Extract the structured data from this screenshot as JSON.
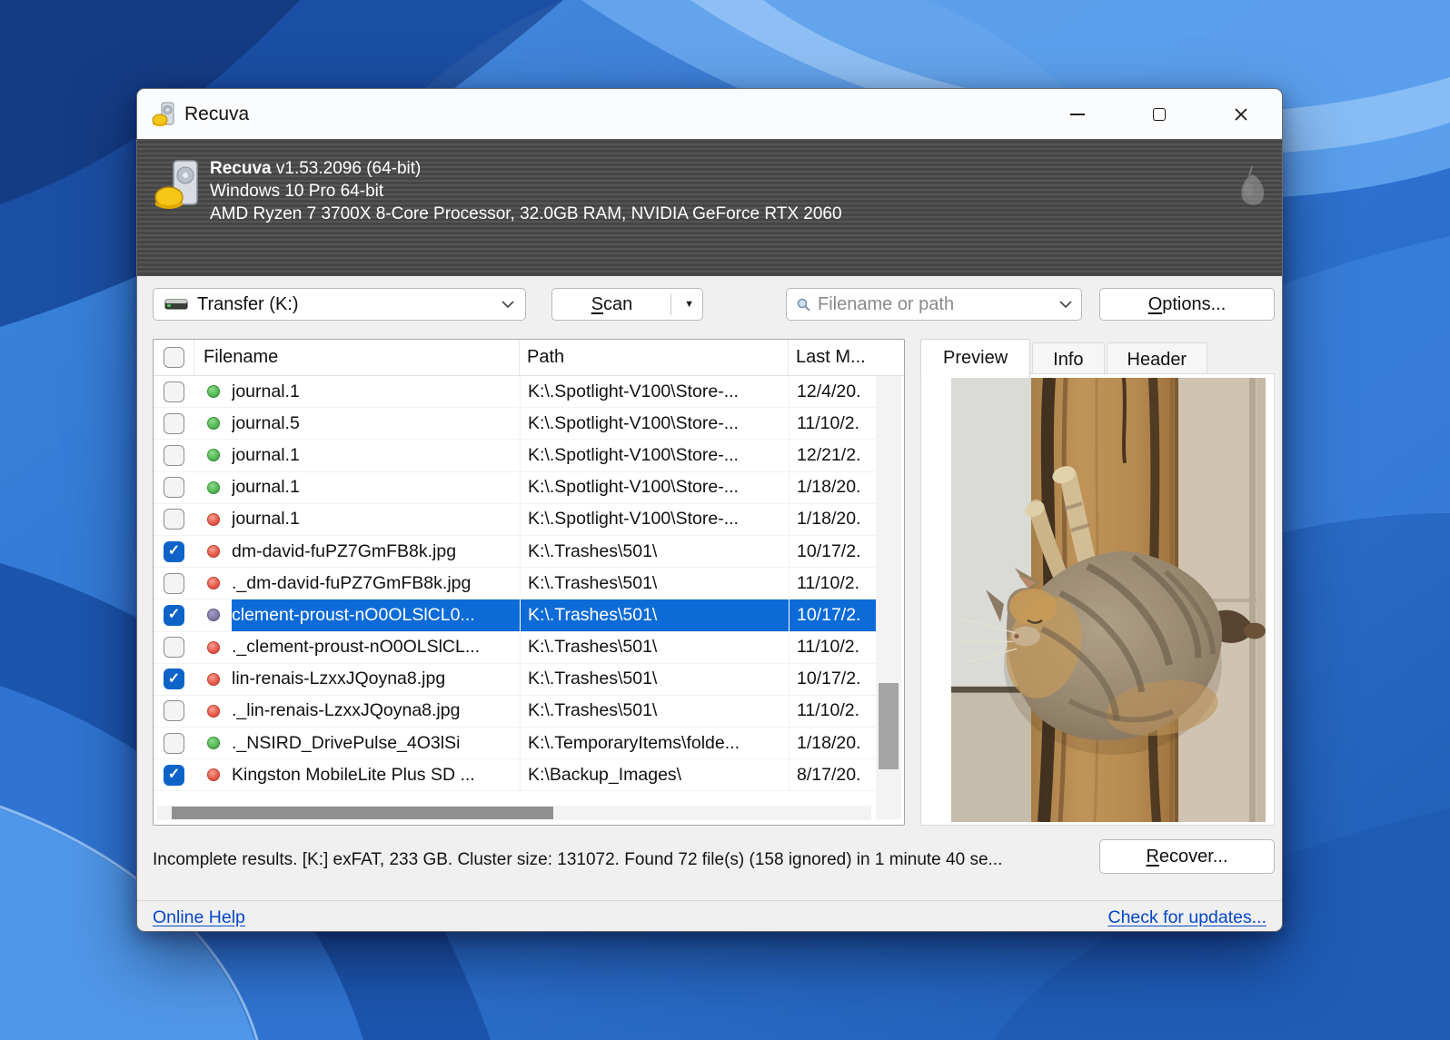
{
  "window": {
    "title": "Recuva"
  },
  "banner": {
    "app_name": "Recuva",
    "version": "v1.53.2096 (64-bit)",
    "os": "Windows 10 Pro 64-bit",
    "hardware": "AMD Ryzen 7 3700X 8-Core Processor, 32.0GB RAM, NVIDIA GeForce RTX 2060"
  },
  "toolbar": {
    "drive_selector_value": "Transfer (K:)",
    "scan_accel": "S",
    "scan_rest": "can",
    "search_placeholder": "Filename or path",
    "options_accel": "O",
    "options_rest": "ptions..."
  },
  "table": {
    "columns": {
      "filename": "Filename",
      "path": "Path",
      "last_modified": "Last M..."
    },
    "rows": [
      {
        "checked": false,
        "status": "green",
        "selected": false,
        "filename": "journal.1",
        "path": "K:\\.Spotlight-V100\\Store-...",
        "last_modified": "12/4/20."
      },
      {
        "checked": false,
        "status": "green",
        "selected": false,
        "filename": "journal.5",
        "path": "K:\\.Spotlight-V100\\Store-...",
        "last_modified": "11/10/2."
      },
      {
        "checked": false,
        "status": "green",
        "selected": false,
        "filename": "journal.1",
        "path": "K:\\.Spotlight-V100\\Store-...",
        "last_modified": "12/21/2."
      },
      {
        "checked": false,
        "status": "green",
        "selected": false,
        "filename": "journal.1",
        "path": "K:\\.Spotlight-V100\\Store-...",
        "last_modified": "1/18/20."
      },
      {
        "checked": false,
        "status": "red",
        "selected": false,
        "filename": "journal.1",
        "path": "K:\\.Spotlight-V100\\Store-...",
        "last_modified": "1/18/20."
      },
      {
        "checked": true,
        "status": "red",
        "selected": false,
        "filename": "dm-david-fuPZ7GmFB8k.jpg",
        "path": "K:\\.Trashes\\501\\",
        "last_modified": "10/17/2."
      },
      {
        "checked": false,
        "status": "red",
        "selected": false,
        "filename": "._dm-david-fuPZ7GmFB8k.jpg",
        "path": "K:\\.Trashes\\501\\",
        "last_modified": "11/10/2."
      },
      {
        "checked": true,
        "status": "purple",
        "selected": true,
        "filename": "clement-proust-nO0OLSlCL0...",
        "path": "K:\\.Trashes\\501\\",
        "last_modified": "10/17/2."
      },
      {
        "checked": false,
        "status": "red",
        "selected": false,
        "filename": "._clement-proust-nO0OLSlCL...",
        "path": "K:\\.Trashes\\501\\",
        "last_modified": "11/10/2."
      },
      {
        "checked": true,
        "status": "red",
        "selected": false,
        "filename": "lin-renais-LzxxJQoyna8.jpg",
        "path": "K:\\.Trashes\\501\\",
        "last_modified": "10/17/2."
      },
      {
        "checked": false,
        "status": "red",
        "selected": false,
        "filename": "._lin-renais-LzxxJQoyna8.jpg",
        "path": "K:\\.Trashes\\501\\",
        "last_modified": "11/10/2."
      },
      {
        "checked": false,
        "status": "green",
        "selected": false,
        "filename": "._NSIRD_DrivePulse_4O3lSi",
        "path": "K:\\.TemporaryItems\\folde...",
        "last_modified": "1/18/20."
      },
      {
        "checked": true,
        "status": "red",
        "selected": false,
        "filename": "Kingston MobileLite Plus SD ...",
        "path": "K:\\Backup_Images\\",
        "last_modified": "8/17/20."
      }
    ]
  },
  "preview": {
    "tabs": [
      "Preview",
      "Info",
      "Header"
    ],
    "active_tab": "Preview"
  },
  "status_bar": {
    "text": "Incomplete results. [K:] exFAT, 233 GB. Cluster size: 131072. Found 72 file(s) (158 ignored) in 1 minute 40 se...",
    "recover_accel": "R",
    "recover_rest": "ecover..."
  },
  "footer": {
    "online_help": "Online Help",
    "check_updates": "Check for updates..."
  },
  "colors": {
    "selection_blue": "#0d6bd7",
    "checkbox_blue": "#0e63c9",
    "status_green": "#4fb54f",
    "status_red": "#e45546",
    "status_purple": "#7d76a3",
    "link_blue": "#0646c8",
    "banner_gray": "#4d4d4d"
  }
}
